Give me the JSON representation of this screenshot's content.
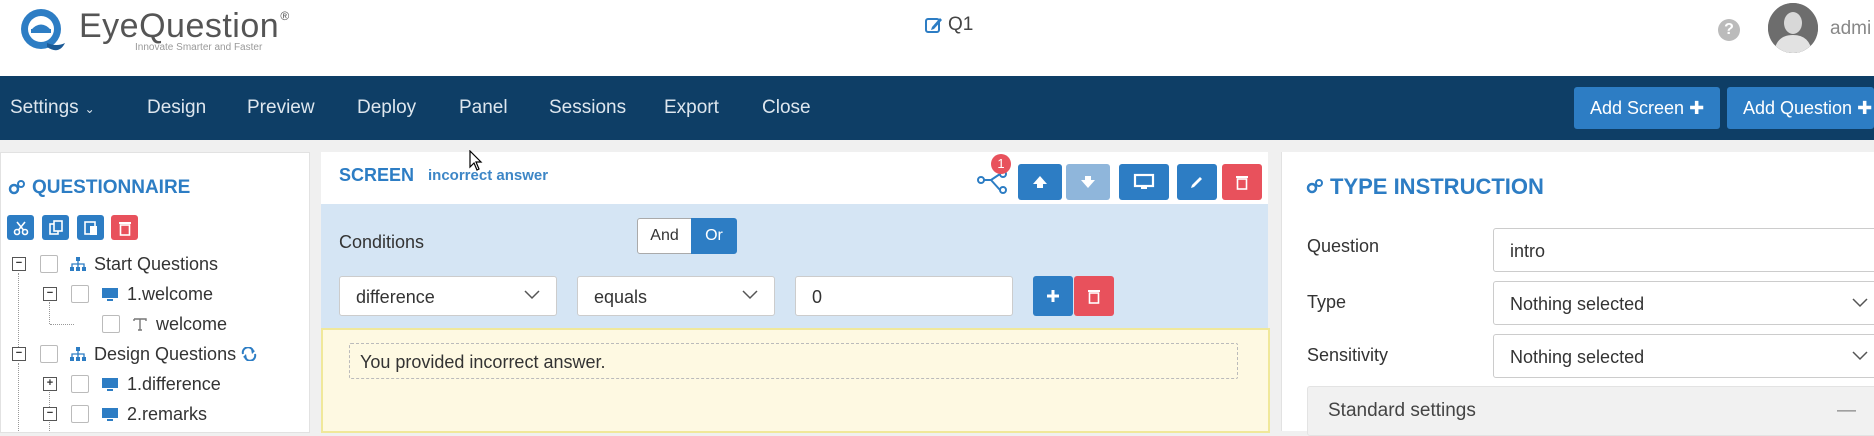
{
  "header": {
    "logo_name": "EyeQuestion",
    "logo_reg": "®",
    "logo_tagline": "Innovate Smarter and Faster",
    "questionnaire_title": "Q1",
    "help_label": "?",
    "user_name": "admi"
  },
  "navbar": {
    "items": [
      {
        "label": "Settings",
        "icon": "caret-down-icon"
      },
      {
        "label": "Design"
      },
      {
        "label": "Preview"
      },
      {
        "label": "Deploy"
      },
      {
        "label": "Panel"
      },
      {
        "label": "Sessions"
      },
      {
        "label": "Export"
      },
      {
        "label": "Close"
      }
    ],
    "add_screen": "Add Screen",
    "add_question": "Add Question"
  },
  "questionnaire": {
    "title": "QUESTIONNAIRE",
    "tree": [
      {
        "label": "Start Questions",
        "expander": "−",
        "icon": "sitemap-icon"
      },
      {
        "label": "1.welcome",
        "expander": "−",
        "icon": "monitor-icon"
      },
      {
        "label": "welcome",
        "expander": "",
        "icon": "text-icon"
      },
      {
        "label": "Design Questions",
        "expander": "−",
        "icon": "sitemap-icon",
        "extra_icon": "loop-icon"
      },
      {
        "label": "1.difference",
        "expander": "+",
        "icon": "monitor-icon"
      },
      {
        "label": "2.remarks",
        "expander": "−",
        "icon": "monitor-icon"
      }
    ]
  },
  "screen": {
    "label": "SCREEN",
    "name": "incorrect answer",
    "branch_badge": "1",
    "conditions_label": "Conditions",
    "logic_and": "And",
    "logic_or": "Or",
    "logic_selected": "Or",
    "condition": {
      "field": "difference",
      "operator": "equals",
      "value": "0"
    },
    "text": "You provided incorrect answer."
  },
  "type_panel": {
    "title": "TYPE INSTRUCTION",
    "question_label": "Question",
    "question_value": "intro",
    "type_label": "Type",
    "type_value": "Nothing selected",
    "sensitivity_label": "Sensitivity",
    "sensitivity_value": "Nothing selected",
    "standard_settings": "Standard settings",
    "collapse_symbol": "—"
  },
  "colors": {
    "navbar": "#0e3e66",
    "primary": "#2d7dc4",
    "danger": "#e8515c",
    "condition_bg": "#d5e5f4",
    "text_bg": "#fef9e2"
  }
}
